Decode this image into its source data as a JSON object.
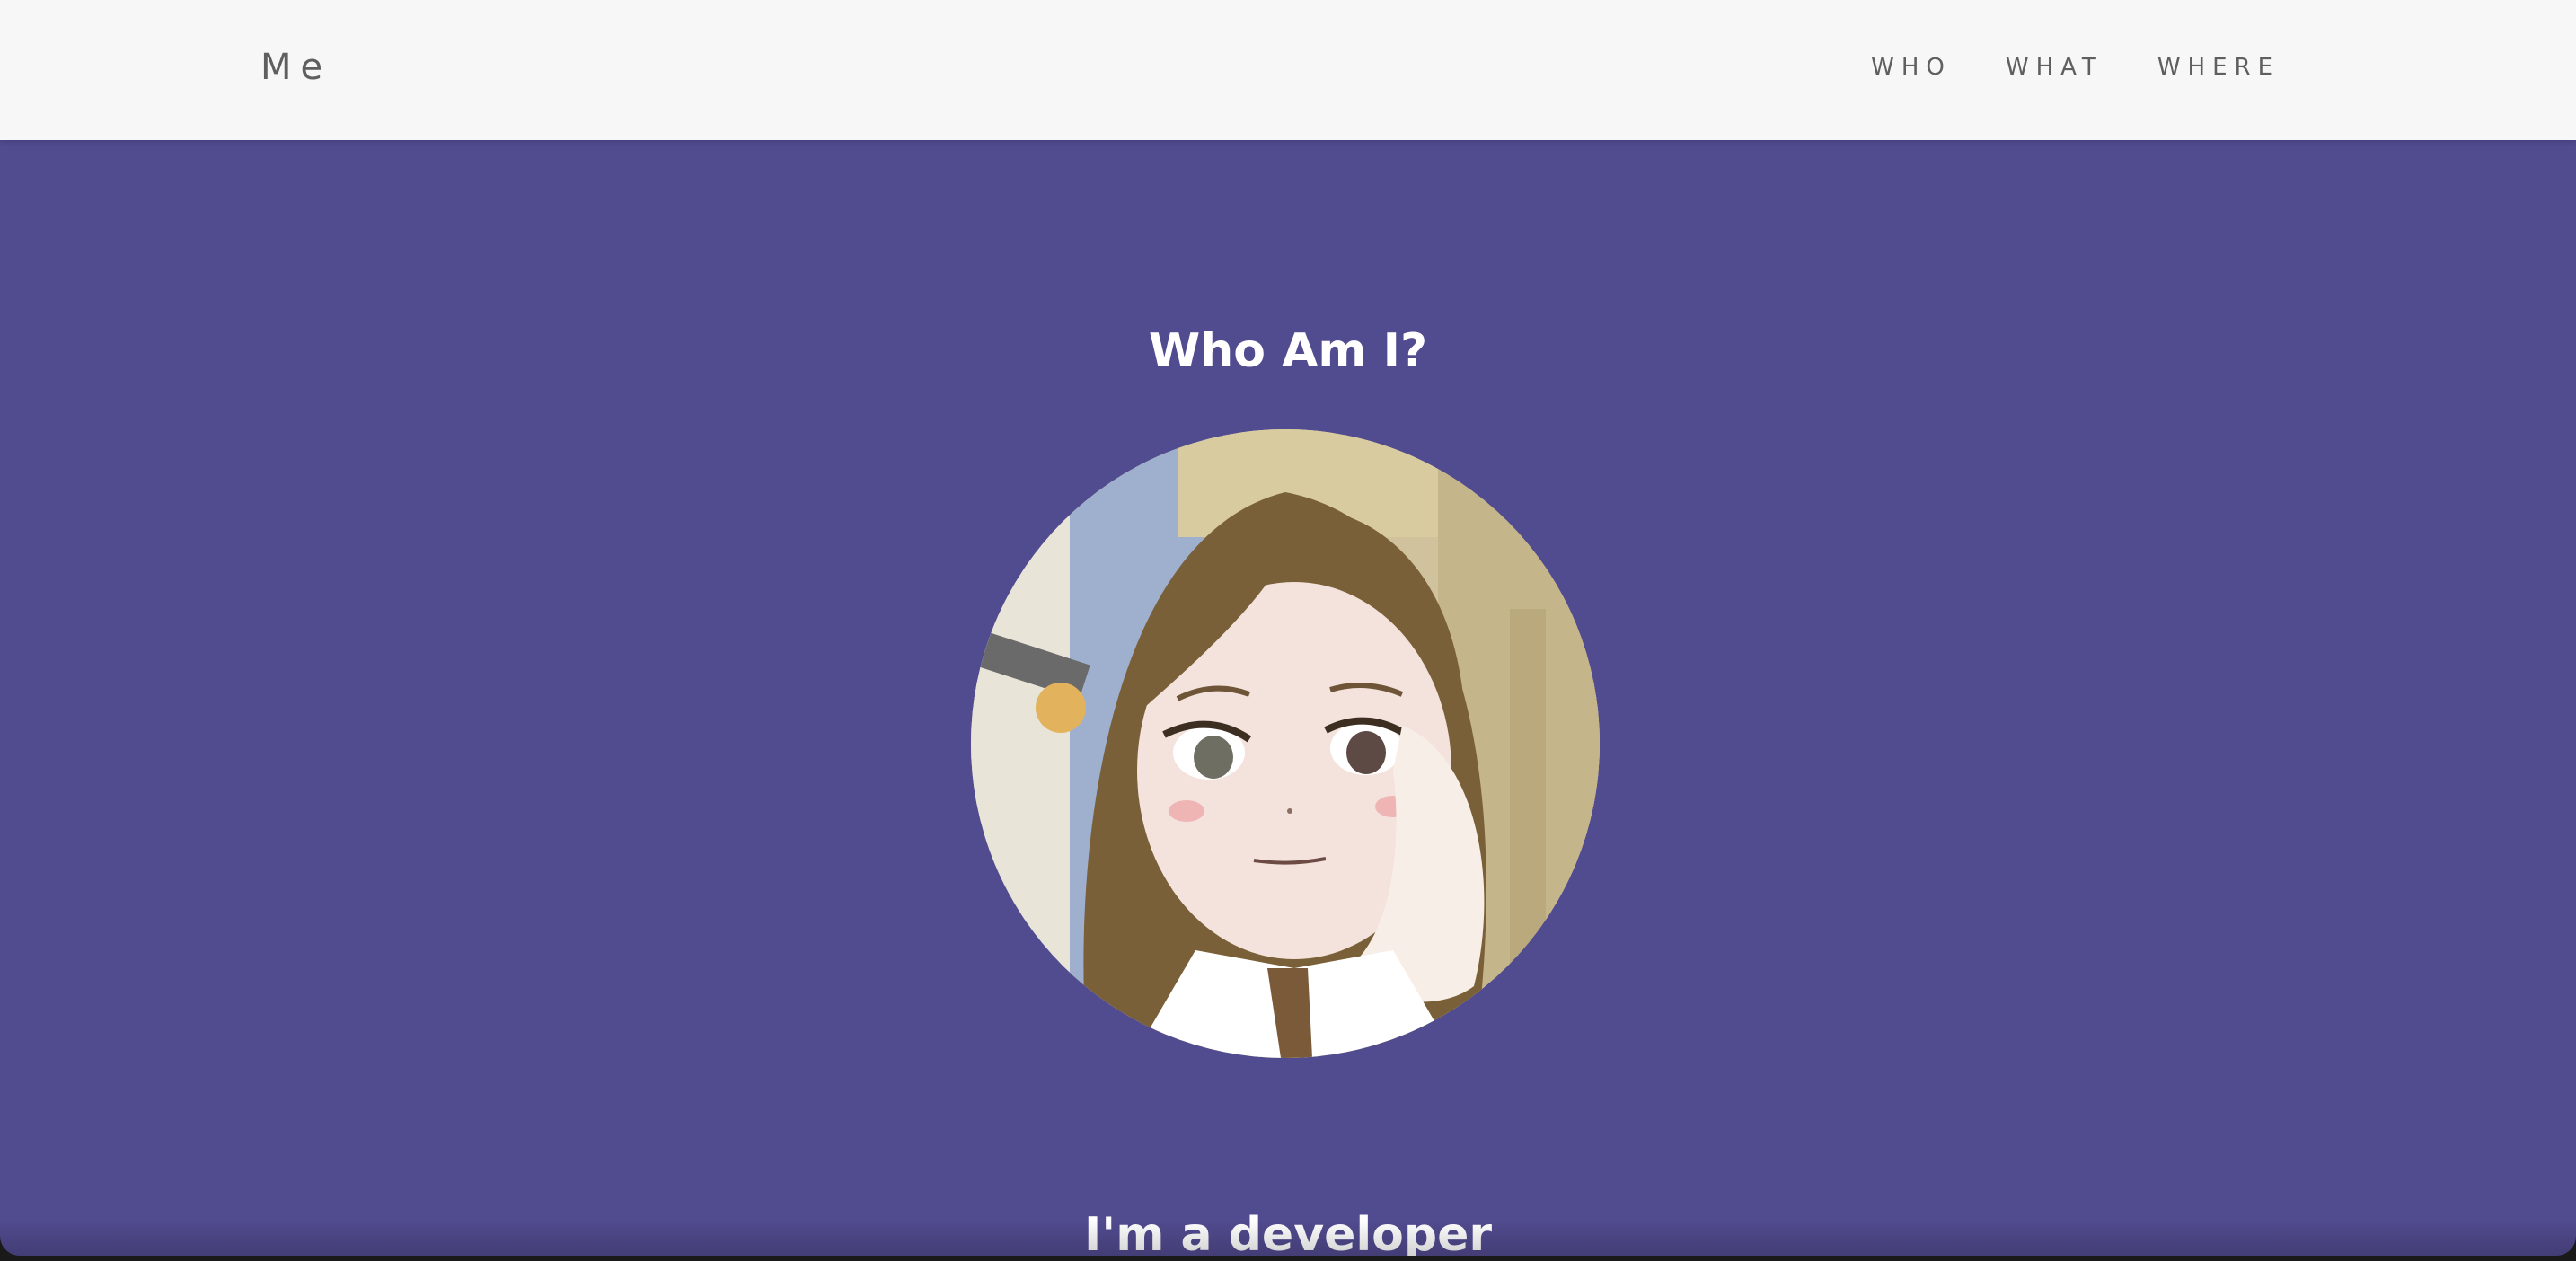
{
  "navbar": {
    "brand": "Me",
    "links": [
      {
        "label": "WHO"
      },
      {
        "label": "WHAT"
      },
      {
        "label": "WHERE"
      }
    ]
  },
  "hero": {
    "title": "Who Am I?",
    "avatar_icon": "anime-girl-portrait",
    "subtitle": "I'm a developer"
  },
  "colors": {
    "navbar_bg": "#f7f7f7",
    "hero_bg": "#514b8f",
    "text_light": "#ffffff",
    "nav_text": "#5f5f5f"
  }
}
